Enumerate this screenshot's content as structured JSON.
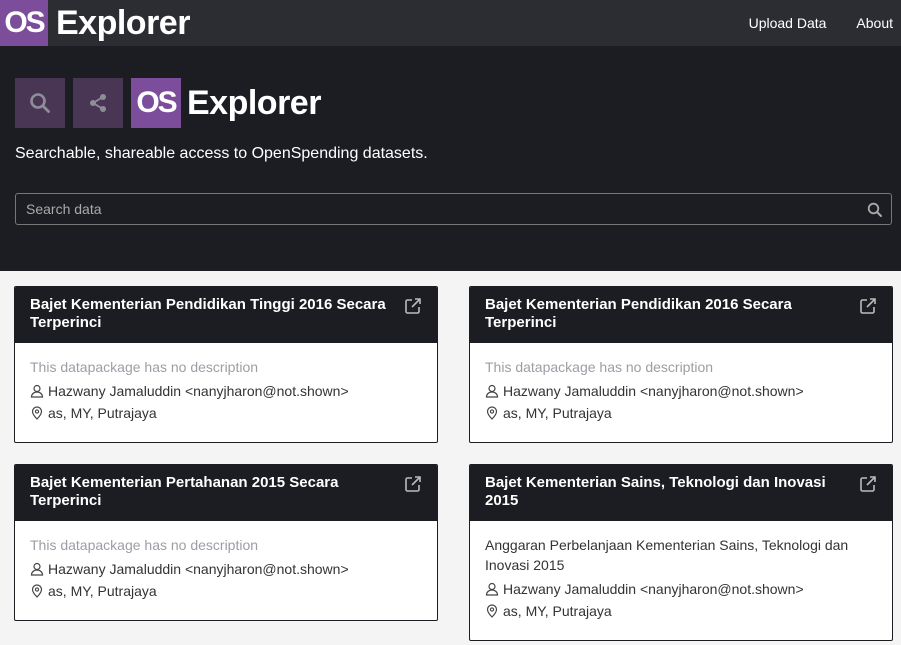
{
  "navbar": {
    "logo_text": "OS",
    "brand": "Explorer",
    "links": [
      "Upload Data",
      "About"
    ]
  },
  "hero": {
    "logo_text": "OS",
    "brand": "Explorer",
    "tagline": "Searchable, shareable access to OpenSpending datasets.",
    "search_placeholder": "Search data"
  },
  "colors": {
    "brand_purple": "#7b4d9a",
    "tile_purple": "#493655",
    "dark_bg": "#1c1d22"
  },
  "cards": [
    {
      "title": "Bajet Kementerian Pendidikan Tinggi 2016 Secara Terperinci",
      "description": "This datapackage has no description",
      "author": "Hazwany Jamaluddin <nanyjharon@not.shown>",
      "location": "as, MY, Putrajaya"
    },
    {
      "title": "Bajet Kementerian Pendidikan 2016 Secara Terperinci",
      "description": "This datapackage has no description",
      "author": "Hazwany Jamaluddin <nanyjharon@not.shown>",
      "location": "as, MY, Putrajaya"
    },
    {
      "title": "Bajet Kementerian Pertahanan 2015 Secara Terperinci",
      "description": "This datapackage has no description",
      "author": "Hazwany Jamaluddin <nanyjharon@not.shown>",
      "location": "as, MY, Putrajaya"
    },
    {
      "title": "Bajet Kementerian Sains, Teknologi dan Inovasi 2015",
      "description": "Anggaran Perbelanjaan Kementerian Sains, Teknologi dan Inovasi 2015",
      "author": "Hazwany Jamaluddin <nanyjharon@not.shown>",
      "location": "as, MY, Putrajaya"
    }
  ]
}
